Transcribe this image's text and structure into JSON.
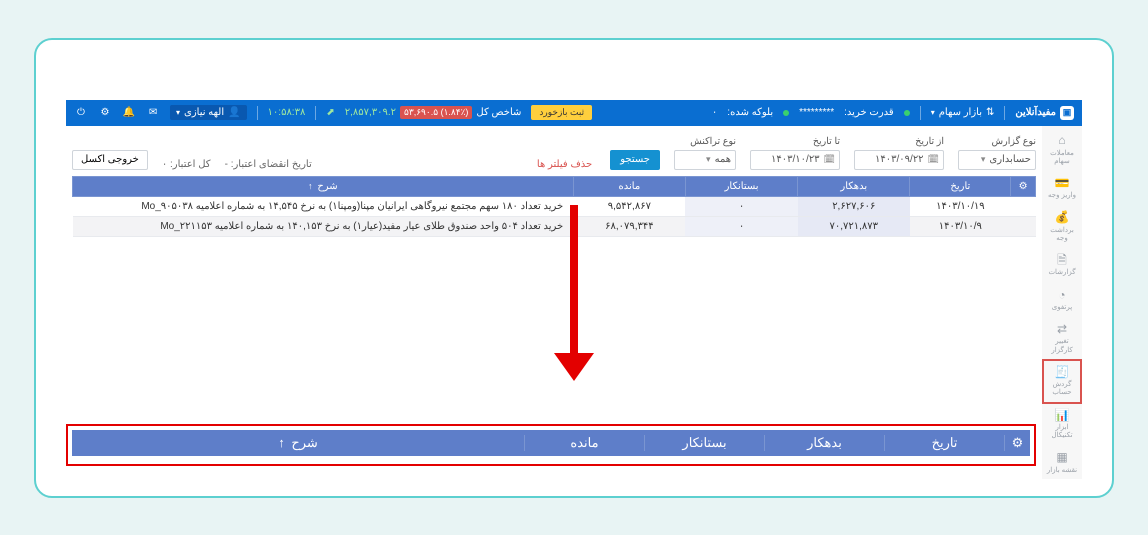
{
  "brand": "مفیدآنلاین",
  "market": {
    "label": "بازار سهام",
    "icon": "ticker"
  },
  "power_label": "قدرت خرید:",
  "power_value": "*********",
  "blocked_label": "بلوکه شده:",
  "blocked_value": "۰",
  "feedback_btn": "ثبت بازخورد",
  "index_label": "شاخص کل",
  "index_change": "(۱.۸۴٪) ۵۳,۶۹۰.۵",
  "index_value": "۲,۸۵۷,۳۰۹.۲",
  "clock": "۱۰:۵۸:۳۸",
  "user_name": "الهه نیازی",
  "sidebar": [
    {
      "label": "معاملات سهام",
      "icon": "home"
    },
    {
      "label": "واریز وجه",
      "icon": "wallet"
    },
    {
      "label": "برداشت وجه",
      "icon": "withdraw"
    },
    {
      "label": "گزارشات",
      "icon": "report"
    },
    {
      "label": "پرتفوی",
      "icon": "pie"
    },
    {
      "label": "تغییر کارگزار",
      "icon": "swap"
    },
    {
      "label": "گردش حساب",
      "icon": "ledger"
    },
    {
      "label": "ابزار تکنیکال",
      "icon": "chart"
    },
    {
      "label": "نقشه بازار",
      "icon": "grid"
    }
  ],
  "filters": {
    "report_type_lbl": "نوع گزارش",
    "report_type_val": "حسابداری",
    "from_lbl": "از تاریخ",
    "from_val": "۱۴۰۳/۰۹/۲۲",
    "to_lbl": "تا تاریخ",
    "to_val": "۱۴۰۳/۱۰/۲۳",
    "txn_lbl": "نوع تراکنش",
    "txn_val": "همه",
    "search": "جستجو",
    "clear": "حذف فیلتر ها",
    "credit_exp_lbl": "تاریخ انقضای اعتبار:",
    "credit_exp_val": "-",
    "credit_total_lbl": "کل اعتبار:",
    "credit_total_val": "۰",
    "excel": "خروجی اکسل"
  },
  "columns": {
    "gear": "⚙",
    "date": "تاریخ",
    "bedehkar": "بدهکار",
    "bestankar": "بستانکار",
    "mandeh": "مانده",
    "desc": "شرح",
    "sort": "↑"
  },
  "rows": [
    {
      "date": "۱۴۰۳/۱۰/۱۹",
      "bedehkar": "۲,۶۲۷,۶۰۶",
      "bestankar": "۰",
      "mandeh": "۹,۵۴۲,۸۶۷",
      "desc": "خرید تعداد ۱۸۰ سهم مجتمع نیروگاهی ایرانیان مپنا(ومپنا۱) به نرخ ۱۴,۵۴۵ به شماره اعلامیه Mo_۹۰۵۰۳۸"
    },
    {
      "date": "۱۴۰۳/۱۰/۹",
      "bedehkar": "۷۰,۷۲۱,۸۷۳",
      "bestankar": "۰",
      "mandeh": "۶۸,۰۷۹,۳۴۴",
      "desc": "خرید تعداد ۵۰۴ واحد صندوق طلای عیار مفید(عیار۱) به نرخ ۱۴۰,۱۵۳ به شماره اعلامیه Mo_۲۲۱۱۵۳"
    }
  ]
}
